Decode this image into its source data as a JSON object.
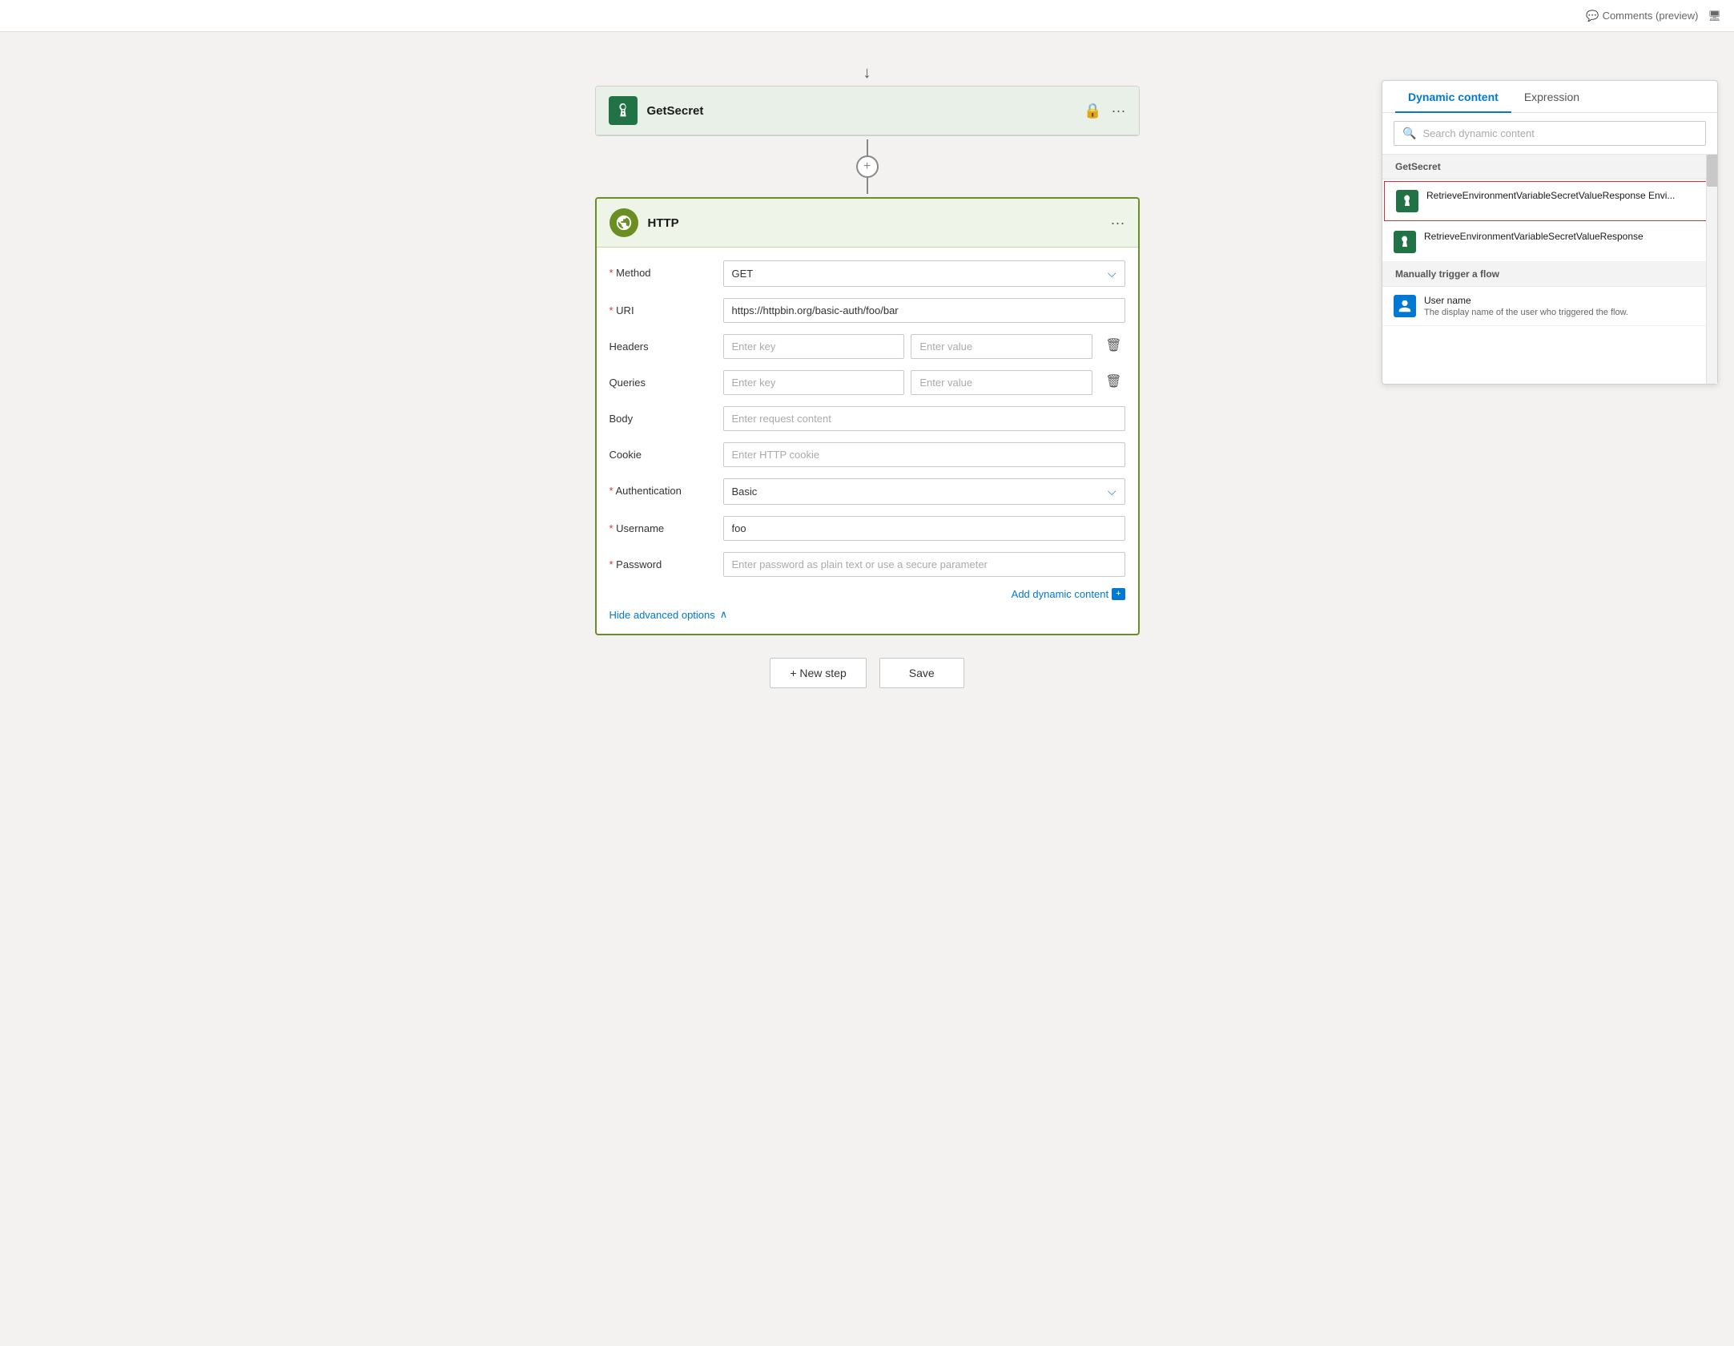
{
  "topbar": {
    "comments_label": "Comments (preview)"
  },
  "getsecret_card": {
    "title": "GetSecret",
    "icon_alt": "key-vault-icon"
  },
  "http_card": {
    "title": "HTTP",
    "method_label": "Method",
    "method_value": "GET",
    "uri_label": "URI",
    "uri_value": "https://httpbin.org/basic-auth/foo/bar",
    "headers_label": "Headers",
    "headers_key_placeholder": "Enter key",
    "headers_value_placeholder": "Enter value",
    "queries_label": "Queries",
    "queries_key_placeholder": "Enter key",
    "queries_value_placeholder": "Enter value",
    "body_label": "Body",
    "body_placeholder": "Enter request content",
    "cookie_label": "Cookie",
    "cookie_placeholder": "Enter HTTP cookie",
    "auth_label": "Authentication",
    "auth_value": "Basic",
    "username_label": "Username",
    "username_value": "foo",
    "password_label": "Password",
    "password_placeholder": "Enter password as plain text or use a secure parameter",
    "add_dynamic_label": "Add dynamic content",
    "hide_advanced_label": "Hide advanced options"
  },
  "bottom_actions": {
    "new_step_label": "+ New step",
    "save_label": "Save"
  },
  "dynamic_panel": {
    "tab_dynamic": "Dynamic content",
    "tab_expression": "Expression",
    "search_placeholder": "Search dynamic content",
    "section_getsecret": "GetSecret",
    "item1_title": "RetrieveEnvironmentVariableSecretValueResponse Envi...",
    "item2_title": "RetrieveEnvironmentVariableSecretValueResponse",
    "section_manual": "Manually trigger a flow",
    "item3_title": "User name",
    "item3_subtitle": "The display name of the user who triggered the flow."
  }
}
